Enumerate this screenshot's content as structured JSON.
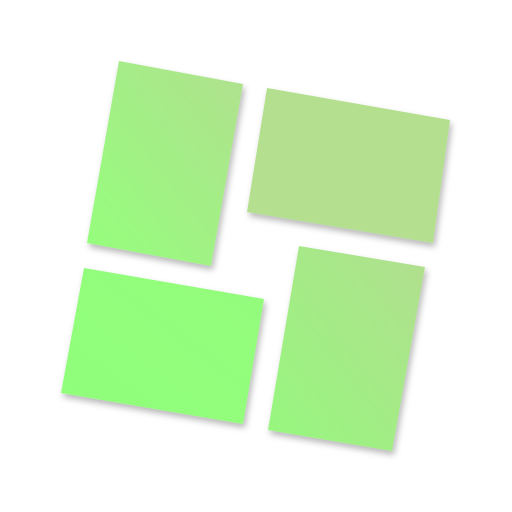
{
  "icon": {
    "name": "app-grid-tiles-icon",
    "colors": {
      "background": "#ffffff",
      "tile_light_green": "#91ff78",
      "tile_sage_green": "#b3df8e",
      "shadow": "#000000"
    },
    "tiles": [
      {
        "id": "top-left",
        "gradient": [
          "#94ff7c",
          "#b1e08f"
        ]
      },
      {
        "id": "top-right",
        "gradient": [
          "#b3df8e",
          "#b3df8e"
        ]
      },
      {
        "id": "bottom-left",
        "gradient": [
          "#8fff7a",
          "#95fc7c"
        ]
      },
      {
        "id": "bottom-right",
        "gradient": [
          "#96f87e",
          "#b2de8f"
        ]
      }
    ]
  }
}
